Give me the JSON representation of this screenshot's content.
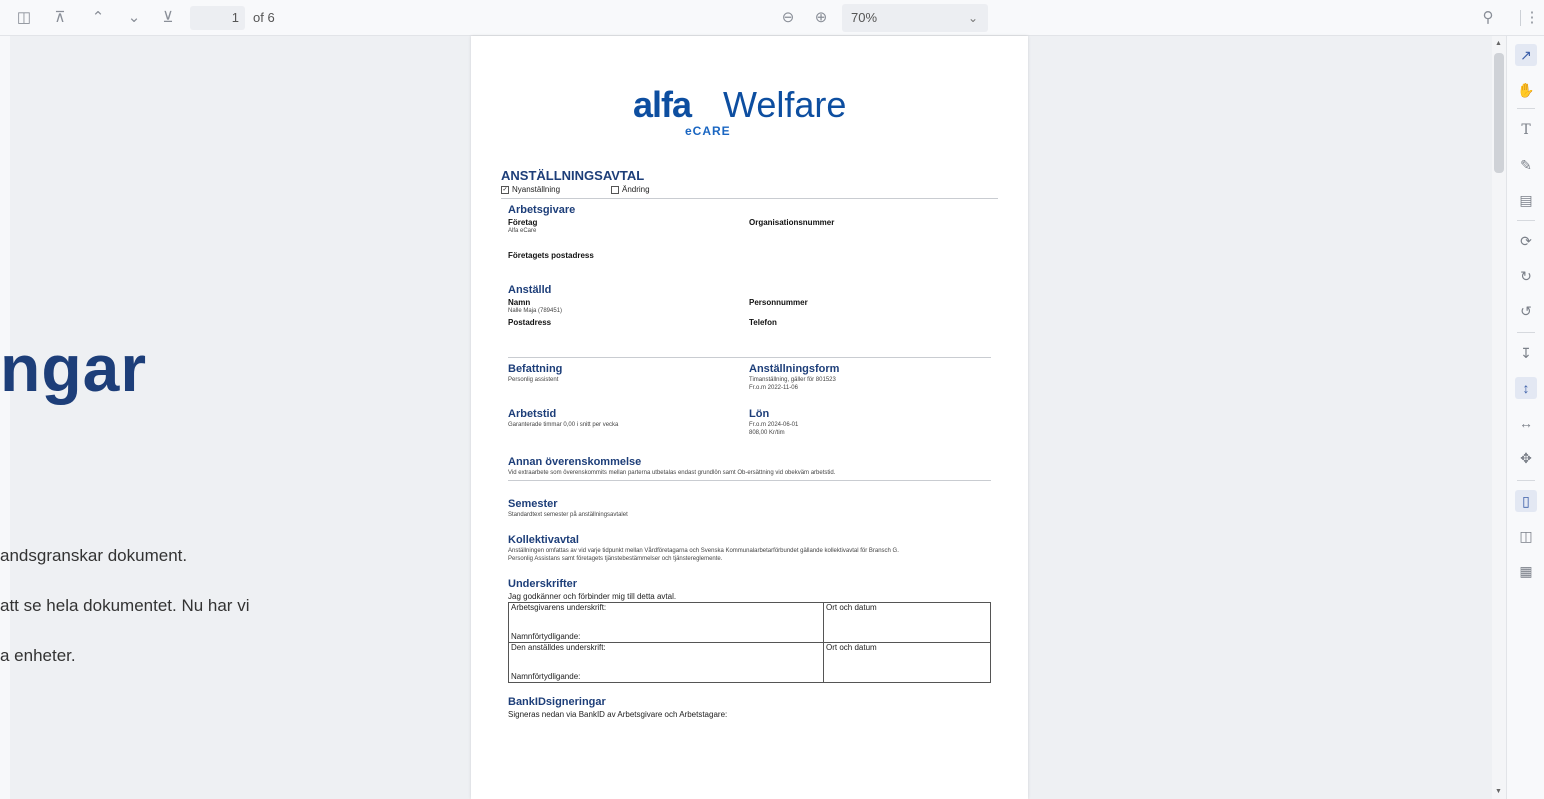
{
  "toolbar": {
    "icons": [
      "sidebar-toggle-icon",
      "first-page-icon",
      "prev-page-icon",
      "next-page-icon",
      "last-page-icon"
    ],
    "page_current": "1",
    "page_of": "of 6",
    "zoom_value": "70%",
    "zoom_out_icon": "zoom-out-icon",
    "zoom_in_icon": "zoom-in-icon",
    "search_icon": "search-icon",
    "more_icon": "more-icon"
  },
  "background": {
    "title_fragment": "ngar",
    "lines": [
      "andsgranskar dokument.",
      "att se hela dokumentet. Nu har vi",
      "a enheter."
    ]
  },
  "sidebar": {
    "tools": [
      "select-icon",
      "hand-icon",
      "text-icon",
      "pen-icon",
      "image-icon",
      "rotate-page-icon",
      "rotate-cw-icon",
      "rotate-ccw-icon",
      "fit-page-icon",
      "fit-height-icon",
      "fit-width-icon",
      "move-icon",
      "single-page-icon",
      "two-page-icon",
      "cover-page-icon"
    ]
  },
  "doc": {
    "logo": {
      "alfa": "alfa",
      "welfare": "Welfare",
      "ecare": "eCARE"
    },
    "title": "ANSTÄLLNINGSAVTAL",
    "check_new": "Nyanställning",
    "check_change": "Ändring",
    "employer": {
      "heading": "Arbetsgivare",
      "company_label": "Företag",
      "company_value": "Alfa eCare",
      "org_label": "Organisationsnummer",
      "address_label": "Företagets postadress"
    },
    "employee": {
      "heading": "Anställd",
      "name_label": "Namn",
      "name_value": "Nalle Maja (789451)",
      "personnr_label": "Personnummer",
      "address_label": "Postadress",
      "phone_label": "Telefon"
    },
    "position": {
      "heading": "Befattning",
      "value": "Personlig assistent"
    },
    "employment_form": {
      "heading": "Anställningsform",
      "value1": "Timanställning, gäller för 801523",
      "value2": "Fr.o.m 2022-11-06"
    },
    "working_time": {
      "heading": "Arbetstid",
      "value": "Garanterade timmar 0,00 i snitt per vecka"
    },
    "salary": {
      "heading": "Lön",
      "value1": "Fr.o.m 2024-06-01",
      "value2": "808,00 Kr/tim"
    },
    "other": {
      "heading": "Annan överenskommelse",
      "value": "Vid extraarbete som överenskommits mellan parterna utbetalas endast grundlön samt Ob-ersättning vid obekväm arbetstid."
    },
    "vacation": {
      "heading": "Semester",
      "value": "Standardtext semester på anställningsavtalet"
    },
    "collective": {
      "heading": "Kollektivavtal",
      "value1": "Anställningen omfattas av vid varje tidpunkt mellan Vårdföretagarna och Svenska Kommunalarbetarförbundet gällande kollektivavtal för Bransch G.",
      "value2": "Personlig Assistans samt företagets tjänstebestämmelser och tjänstereglemente."
    },
    "signatures": {
      "heading": "Underskrifter",
      "intro": "Jag godkänner och förbinder mig till detta avtal.",
      "employer_sig": "Arbetsgivarens underskrift:",
      "place_date": "Ort och datum",
      "name_clar": "Namnförtydligande:",
      "employee_sig": "Den anställdes underskrift:"
    },
    "bankid": {
      "heading": "BankIDsigneringar",
      "value": "Signeras nedan via BankID av Arbetsgivare och Arbetstagare:"
    }
  }
}
